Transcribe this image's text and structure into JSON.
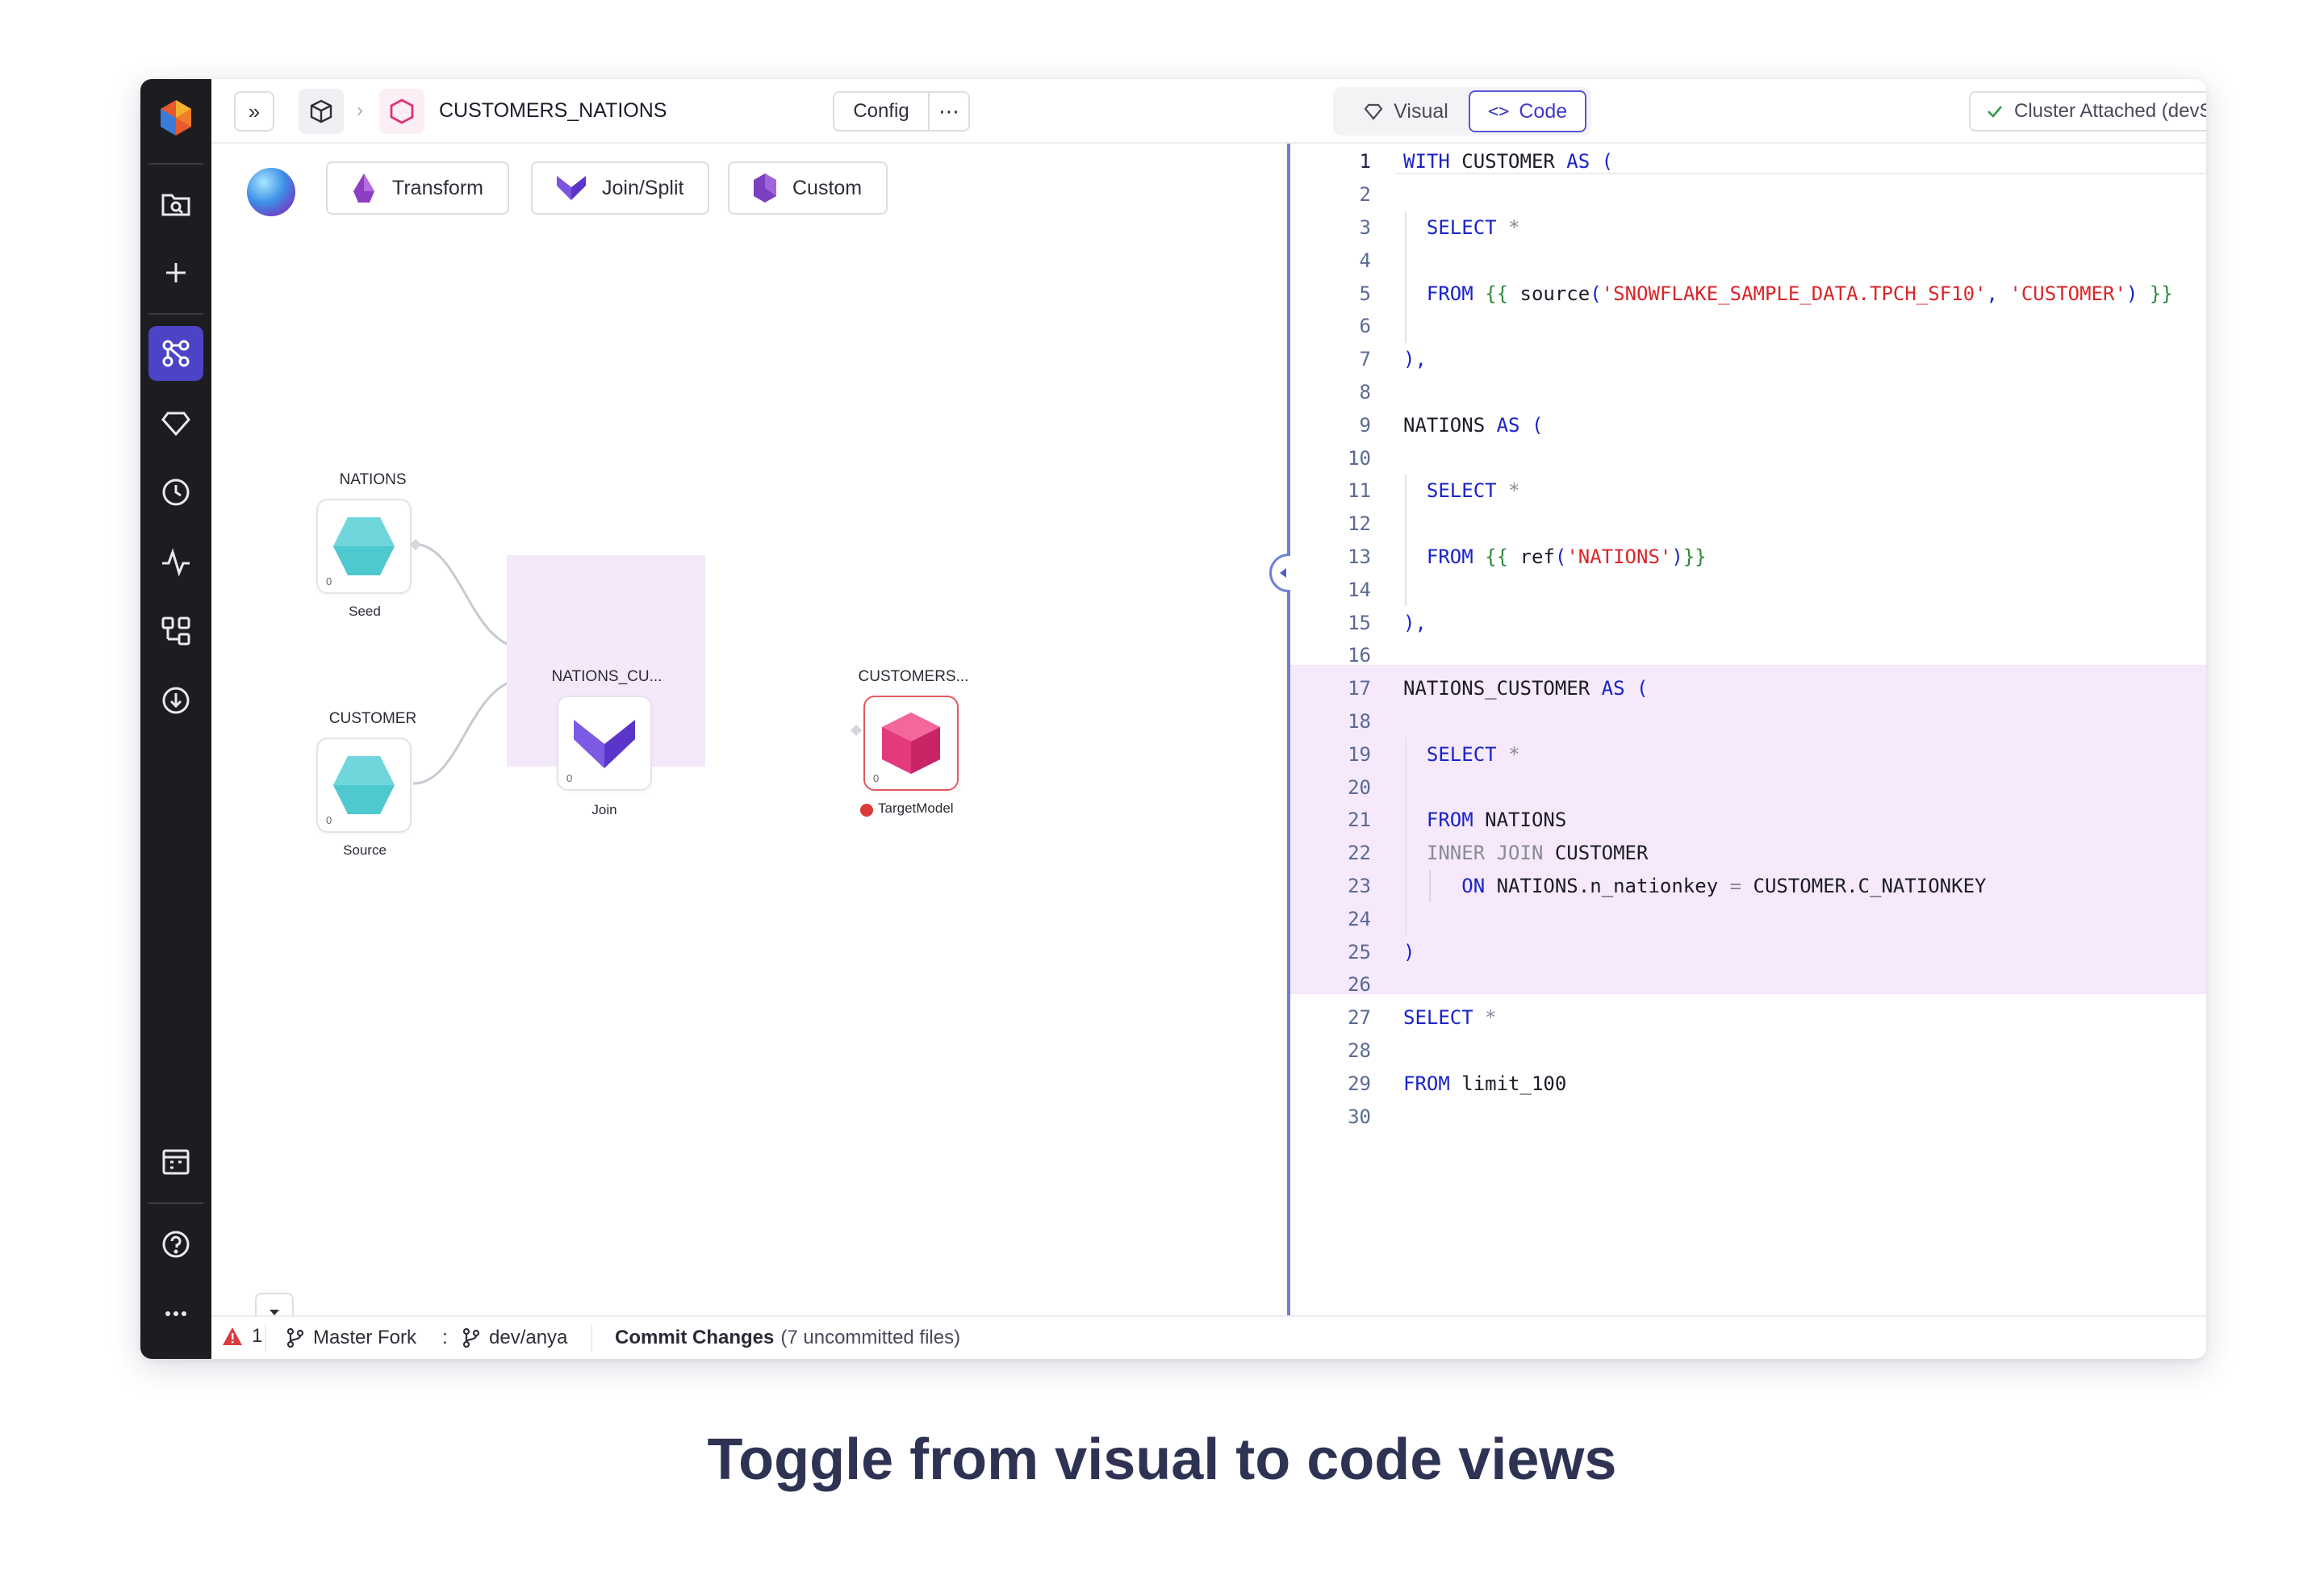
{
  "app": {
    "pipeline_name": "CUSTOMERS_NATIONS",
    "config_label": "Config",
    "more_label": "⋯"
  },
  "view_toggle": {
    "visual_label": "Visual",
    "code_label": "Code",
    "active": "Code"
  },
  "cluster": {
    "label": "Cluster Attached (devSnowfl..."
  },
  "gems": [
    {
      "label": "Transform",
      "color": "#8b3fc4"
    },
    {
      "label": "Join/Split",
      "color": "#5b35c9"
    },
    {
      "label": "Custom",
      "color": "#7b3fc0"
    }
  ],
  "nodes": {
    "nations": {
      "title": "NATIONS",
      "type": "Seed",
      "count": "0"
    },
    "customer": {
      "title": "CUSTOMER",
      "type": "Source",
      "count": "0"
    },
    "join": {
      "title": "NATIONS_CU...",
      "type": "Join",
      "count": "0"
    },
    "target": {
      "title": "CUSTOMERS...",
      "type": "TargetModel",
      "count": "0"
    }
  },
  "code_lines": [
    "WITH CUSTOMER AS (",
    "",
    "  SELECT *",
    "",
    "  FROM {{ source('SNOWFLAKE_SAMPLE_DATA.TPCH_SF10', 'CUSTOMER') }}",
    "",
    "),",
    "",
    "NATIONS AS (",
    "",
    "  SELECT *",
    "",
    "  FROM {{ ref('NATIONS')}}",
    "",
    "),",
    "",
    "NATIONS_CUSTOMER AS (",
    "",
    "  SELECT *",
    "",
    "  FROM NATIONS",
    "  INNER JOIN CUSTOMER",
    "     ON NATIONS.n_nationkey = CUSTOMER.C_NATIONKEY",
    "",
    ")",
    "",
    "SELECT *",
    "",
    "FROM limit_100",
    ""
  ],
  "line_numbers": [
    "1",
    "2",
    "3",
    "4",
    "5",
    "6",
    "7",
    "8",
    "9",
    "10",
    "11",
    "12",
    "13",
    "14",
    "15",
    "16",
    "17",
    "18",
    "19",
    "20",
    "21",
    "22",
    "23",
    "24",
    "25",
    "26",
    "27",
    "28",
    "29",
    "30"
  ],
  "status_bar": {
    "error_count": "1",
    "fork": "Master Fork",
    "separator": ":",
    "branch": "dev/anya",
    "commit_label": "Commit Changes",
    "uncommitted": "(7 uncommitted files)"
  },
  "caption": "Toggle from visual to code views",
  "colors": {
    "sidebar_bg": "#1d1c21",
    "active_accent": "#4d43c5",
    "divider": "#6d7fd6",
    "highlight": "#f5e9fb",
    "error": "#d93a3a",
    "seed": "#4fc9d0",
    "target": "#e23a7c"
  },
  "icons": {
    "sidebar": [
      "prophecy-logo-icon",
      "search-folder-icon",
      "plus-icon",
      "pipeline-icon",
      "gem-icon",
      "clock-icon",
      "activity-icon",
      "graph-icon",
      "download-icon",
      "calendar-icon",
      "help-icon",
      "more-icon"
    ]
  }
}
